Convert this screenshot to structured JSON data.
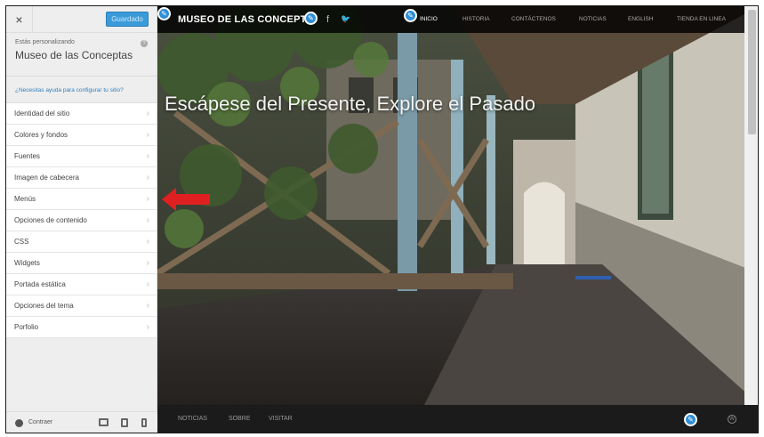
{
  "sidebar": {
    "close_label": "×",
    "save_label": "Guardado",
    "info_small": "Estás personalizando",
    "info_title": "Museo de las Conceptas",
    "help_icon": "?",
    "help_link": "¿Necesitas ayuda para configurar tu sitio?",
    "items": [
      {
        "label": "Identidad del sitio"
      },
      {
        "label": "Colores y fondos"
      },
      {
        "label": "Fuentes"
      },
      {
        "label": "Imagen de cabecera"
      },
      {
        "label": "Menús"
      },
      {
        "label": "Opciones de contenido"
      },
      {
        "label": "CSS"
      },
      {
        "label": "Widgets"
      },
      {
        "label": "Portada estática"
      },
      {
        "label": "Opciones del tema"
      },
      {
        "label": "Porfolio"
      }
    ],
    "chevron": "›",
    "collapse_label": "Contraer"
  },
  "preview": {
    "site_title": "MUSEO DE LAS CONCEPTA",
    "social": {
      "facebook": "f",
      "twitter": "🐦"
    },
    "nav": [
      "INICIO",
      "HISTORIA",
      "CONTÁCTENOS",
      "NOTICIAS",
      "ENGLISH",
      "TIENDA EN LINEA"
    ],
    "hero_title": "Escápese del Presente, Explore el Pasado",
    "footer_links": [
      "NOTICIAS",
      "SOBRE",
      "VISITAR"
    ],
    "pencil_glyph": "✎",
    "wp_glyph": "W"
  },
  "colors": {
    "accent": "#3b9bd9",
    "link": "#2f80c0",
    "annotation_arrow": "#e02020"
  },
  "icons": [
    "close-icon",
    "help-icon",
    "chevron-right-icon",
    "pencil-icon",
    "facebook-icon",
    "twitter-icon",
    "wordpress-icon",
    "collapse-icon",
    "desktop-icon",
    "tablet-icon",
    "mobile-icon",
    "red-arrow-icon"
  ]
}
